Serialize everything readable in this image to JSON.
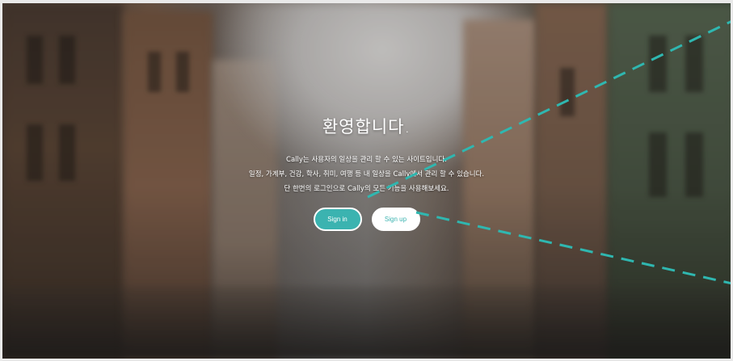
{
  "hero": {
    "title": "환영합니다.",
    "lines": [
      "Cally는 사용자의 일상을 관리 할 수 있는 사이트입니다.",
      "일정, 가계부, 건강, 학사, 취미, 여행 등 내 일상을 Cally에서 관리 할 수 있습니다.",
      "단 한번의 로그인으로 Cally의 모든 기능을 사용해보세요."
    ]
  },
  "buttons": {
    "signin_label": "Sign in",
    "signup_label": "Sign up"
  },
  "colors": {
    "accent": "#3bb3b0",
    "text": "#ffffff",
    "annotation_dash": "#2fb7b0"
  }
}
